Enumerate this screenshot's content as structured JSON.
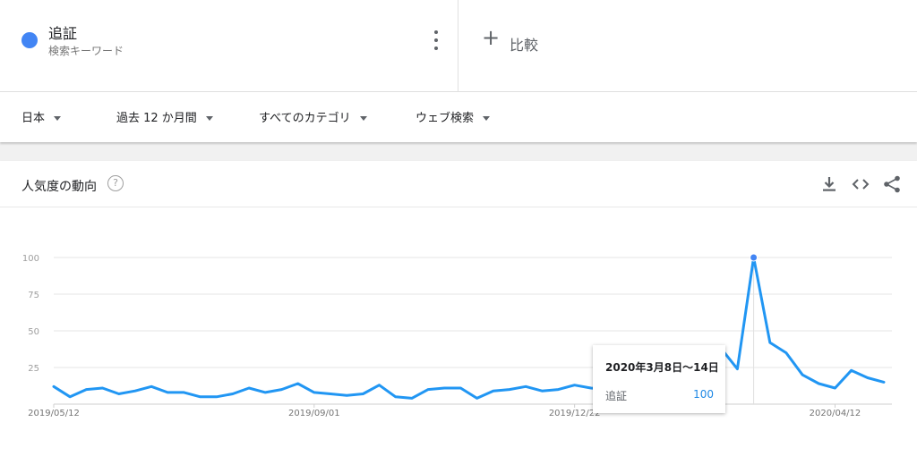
{
  "search_term": {
    "name": "追証",
    "type_label": "検索キーワード",
    "color": "#4285f4"
  },
  "compare": {
    "label": "比較"
  },
  "filters": {
    "region": "日本",
    "period": "過去 12 か月間",
    "category": "すべてのカテゴリ",
    "source": "ウェブ検索"
  },
  "card": {
    "title": "人気度の動向",
    "help_glyph": "?"
  },
  "icons": {
    "download": "download-icon",
    "embed": "embed-code-icon",
    "share": "share-icon",
    "more": "more-vert-icon",
    "add": "plus-icon"
  },
  "tooltip": {
    "date": "2020年3月8日〜14日",
    "term": "追証",
    "value": "100"
  },
  "chart_data": {
    "type": "line",
    "title": "",
    "xlabel": "",
    "ylabel": "",
    "ylim": [
      0,
      100
    ],
    "yticks": [
      25,
      50,
      75,
      100
    ],
    "x_tick_labels": [
      {
        "label": "2019/05/12",
        "index": 0
      },
      {
        "label": "2019/09/01",
        "index": 16
      },
      {
        "label": "2019/12/22",
        "index": 32
      },
      {
        "label": "2020/04/12",
        "index": 48
      }
    ],
    "grid": true,
    "line_color": "#2196f3",
    "highlighted_index": 43,
    "series": [
      {
        "name": "追証",
        "values": [
          12,
          5,
          10,
          11,
          7,
          9,
          12,
          8,
          8,
          5,
          5,
          7,
          11,
          8,
          10,
          14,
          8,
          7,
          6,
          7,
          13,
          5,
          4,
          10,
          11,
          11,
          4,
          9,
          10,
          12,
          9,
          10,
          13,
          11,
          10,
          9,
          10,
          14,
          11,
          8,
          14,
          38,
          24,
          100,
          42,
          35,
          20,
          14,
          11,
          23,
          18,
          15
        ]
      }
    ]
  }
}
